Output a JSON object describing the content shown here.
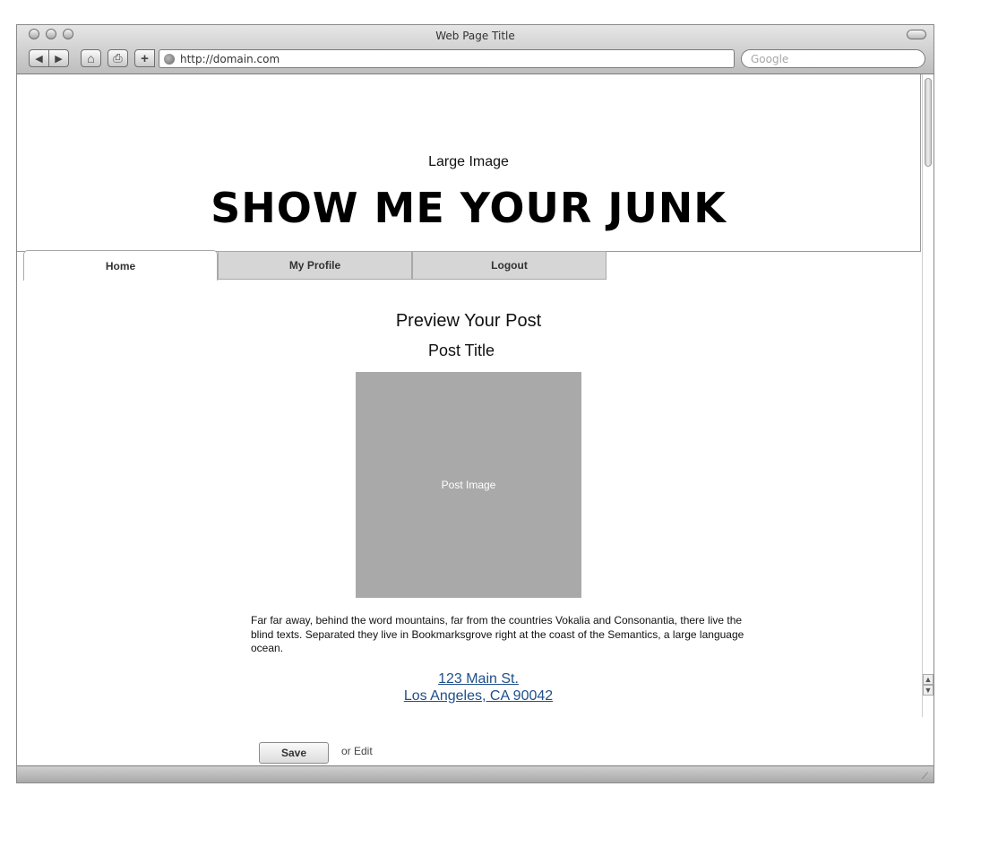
{
  "window": {
    "title": "Web Page Title",
    "url": "http://domain.com",
    "search_placeholder": "Google"
  },
  "toolbar": {
    "back_icon": "◀",
    "forward_icon": "▶",
    "home_icon": "⌂",
    "print_icon": "⎙",
    "add_icon": "+"
  },
  "hero": {
    "label": "Large Image",
    "title": "SHOW ME YOUR JUNK"
  },
  "tabs": [
    {
      "label": "Home",
      "active": true
    },
    {
      "label": "My Profile",
      "active": false
    },
    {
      "label": "Logout",
      "active": false
    }
  ],
  "main": {
    "heading": "Preview Your Post",
    "post_title": "Post Title",
    "image_label": "Post Image",
    "body": "Far far away, behind the word mountains, far from the countries Vokalia and Consonantia, there live the blind texts. Separated they live in Bookmarksgrove right at the coast of the Semantics, a large language ocean.",
    "address_line1": "123 Main St.",
    "address_line2": "Los Angeles, CA 90042",
    "save_label": "Save",
    "edit_label": "or Edit"
  },
  "colors": {
    "link": "#1f4f8a",
    "image_placeholder": "#a9a9a9",
    "tab_inactive": "#d6d6d6"
  }
}
